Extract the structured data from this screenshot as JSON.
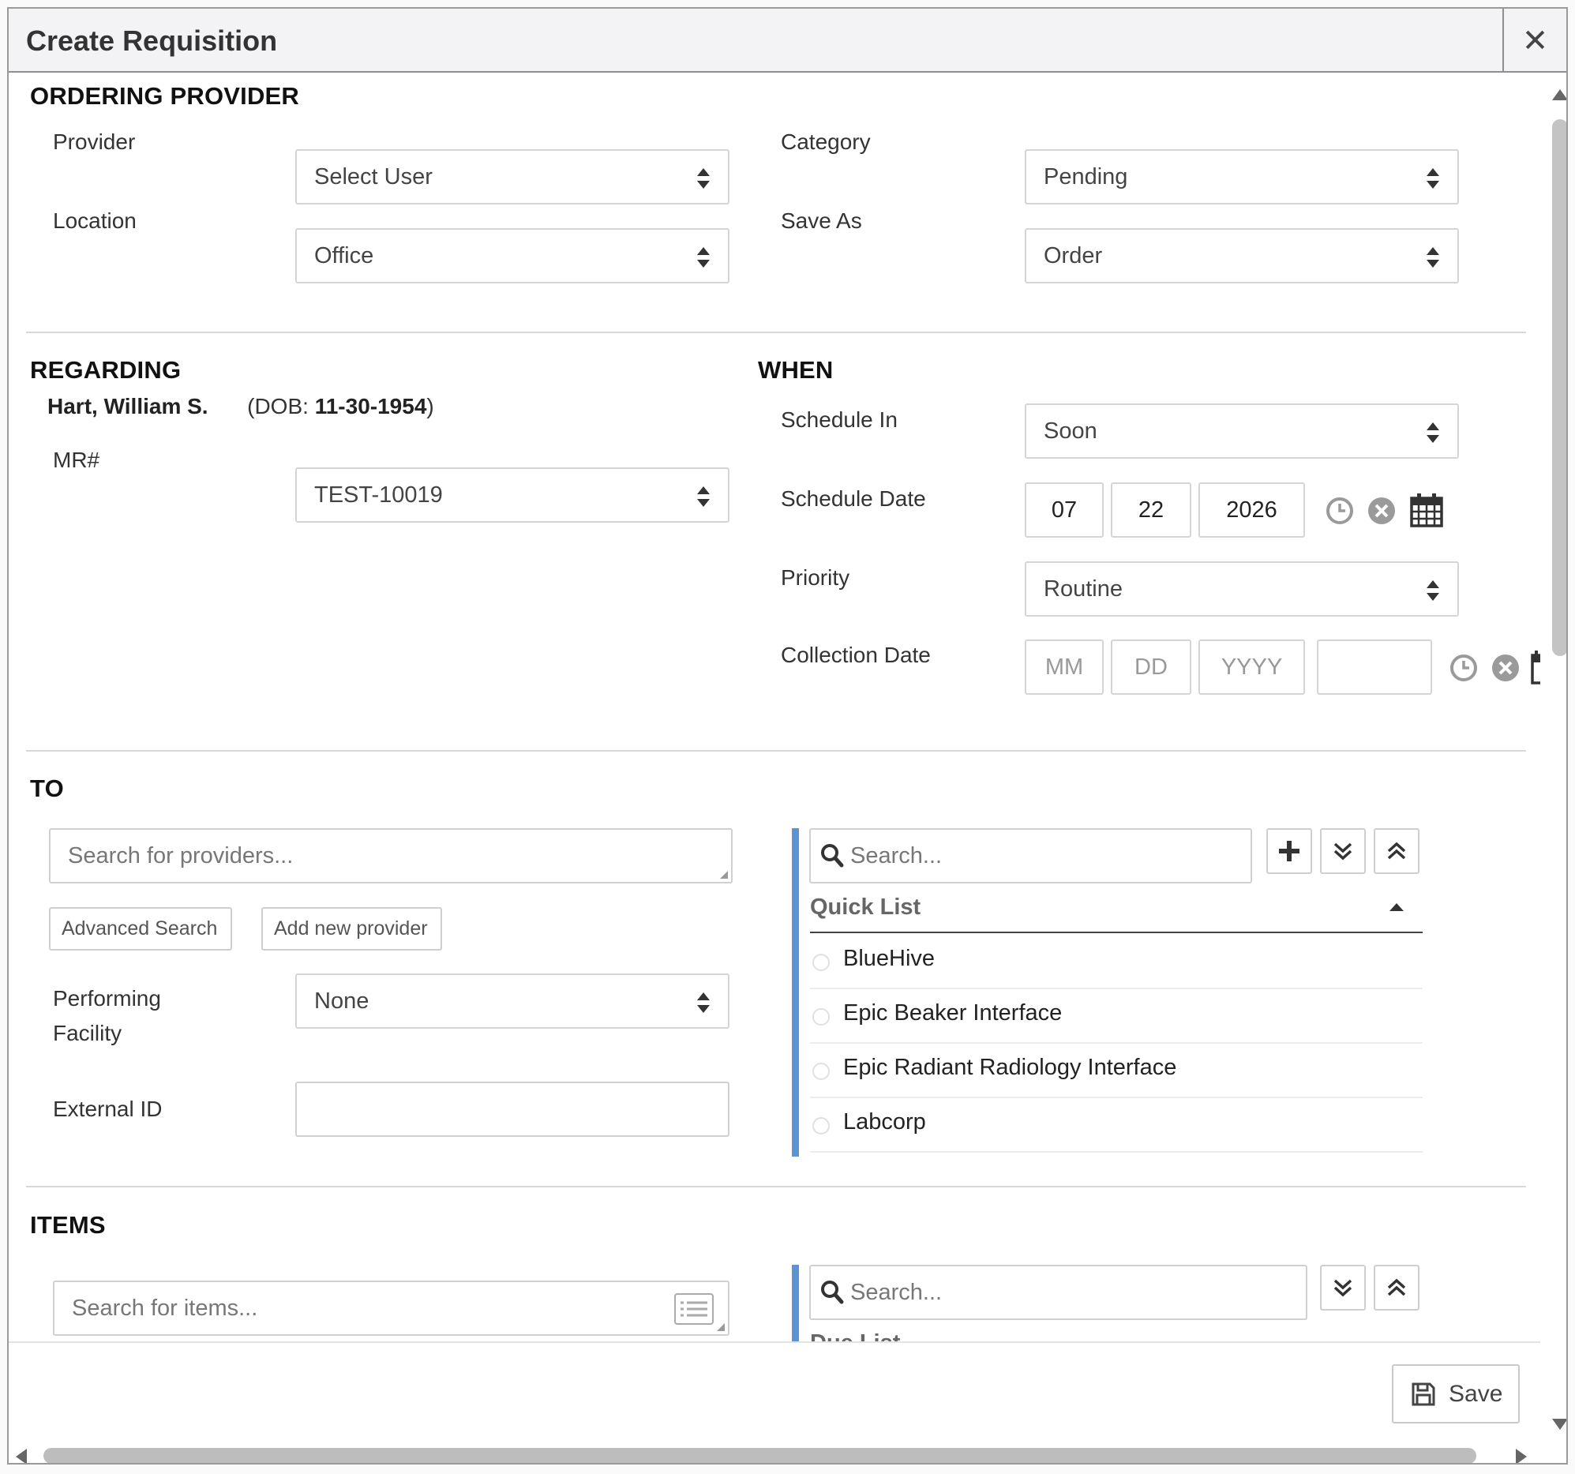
{
  "dialog": {
    "title": "Create Requisition"
  },
  "ordering_provider": {
    "heading": "ORDERING PROVIDER",
    "provider_label": "Provider",
    "provider_value": "Select User",
    "location_label": "Location",
    "location_value": "Office",
    "category_label": "Category",
    "category_value": "Pending",
    "save_as_label": "Save As",
    "save_as_value": "Order"
  },
  "regarding": {
    "heading": "REGARDING",
    "patient_name": "Hart, William S.",
    "dob_prefix": "(DOB: ",
    "dob_value": "11-30-1954",
    "dob_suffix": ")",
    "mr_label": "MR#",
    "mr_value": "TEST-10019"
  },
  "when": {
    "heading": "WHEN",
    "schedule_in_label": "Schedule In",
    "schedule_in_value": "Soon",
    "schedule_date_label": "Schedule Date",
    "schedule_date": {
      "mm": "07",
      "dd": "22",
      "yyyy": "2026"
    },
    "priority_label": "Priority",
    "priority_value": "Routine",
    "collection_date_label": "Collection Date",
    "collection_date_placeholders": {
      "mm": "MM",
      "dd": "DD",
      "yyyy": "YYYY",
      "time": ""
    }
  },
  "to": {
    "heading": "TO",
    "provider_search_placeholder": "Search for providers...",
    "advanced_search_label": "Advanced Search",
    "add_new_provider_label": "Add new provider",
    "performing_facility_label_line1": "Performing",
    "performing_facility_label_line2": "Facility",
    "performing_facility_value": "None",
    "external_id_label": "External ID",
    "external_id_value": "",
    "quick_search_placeholder": "Search...",
    "quick_list_heading": "Quick List",
    "quick_list_items": [
      "BlueHive",
      "Epic Beaker Interface",
      "Epic Radiant Radiology Interface",
      "Labcorp"
    ]
  },
  "items": {
    "heading": "ITEMS",
    "item_search_placeholder": "Search for items...",
    "quick_search_placeholder": "Search...",
    "list_heading_partial": "Due List"
  },
  "footer": {
    "save_label": "Save"
  },
  "colors": {
    "accent_bar": "#5b93d3",
    "title_bg": "#f3f3f6"
  },
  "icons": [
    "close-icon",
    "sort-arrows-icon",
    "clock-icon",
    "clear-icon",
    "calendar-icon",
    "search-icon",
    "plus-icon",
    "expand-all-icon",
    "collapse-all-icon",
    "caret-up-icon",
    "list-icon",
    "save-icon"
  ]
}
